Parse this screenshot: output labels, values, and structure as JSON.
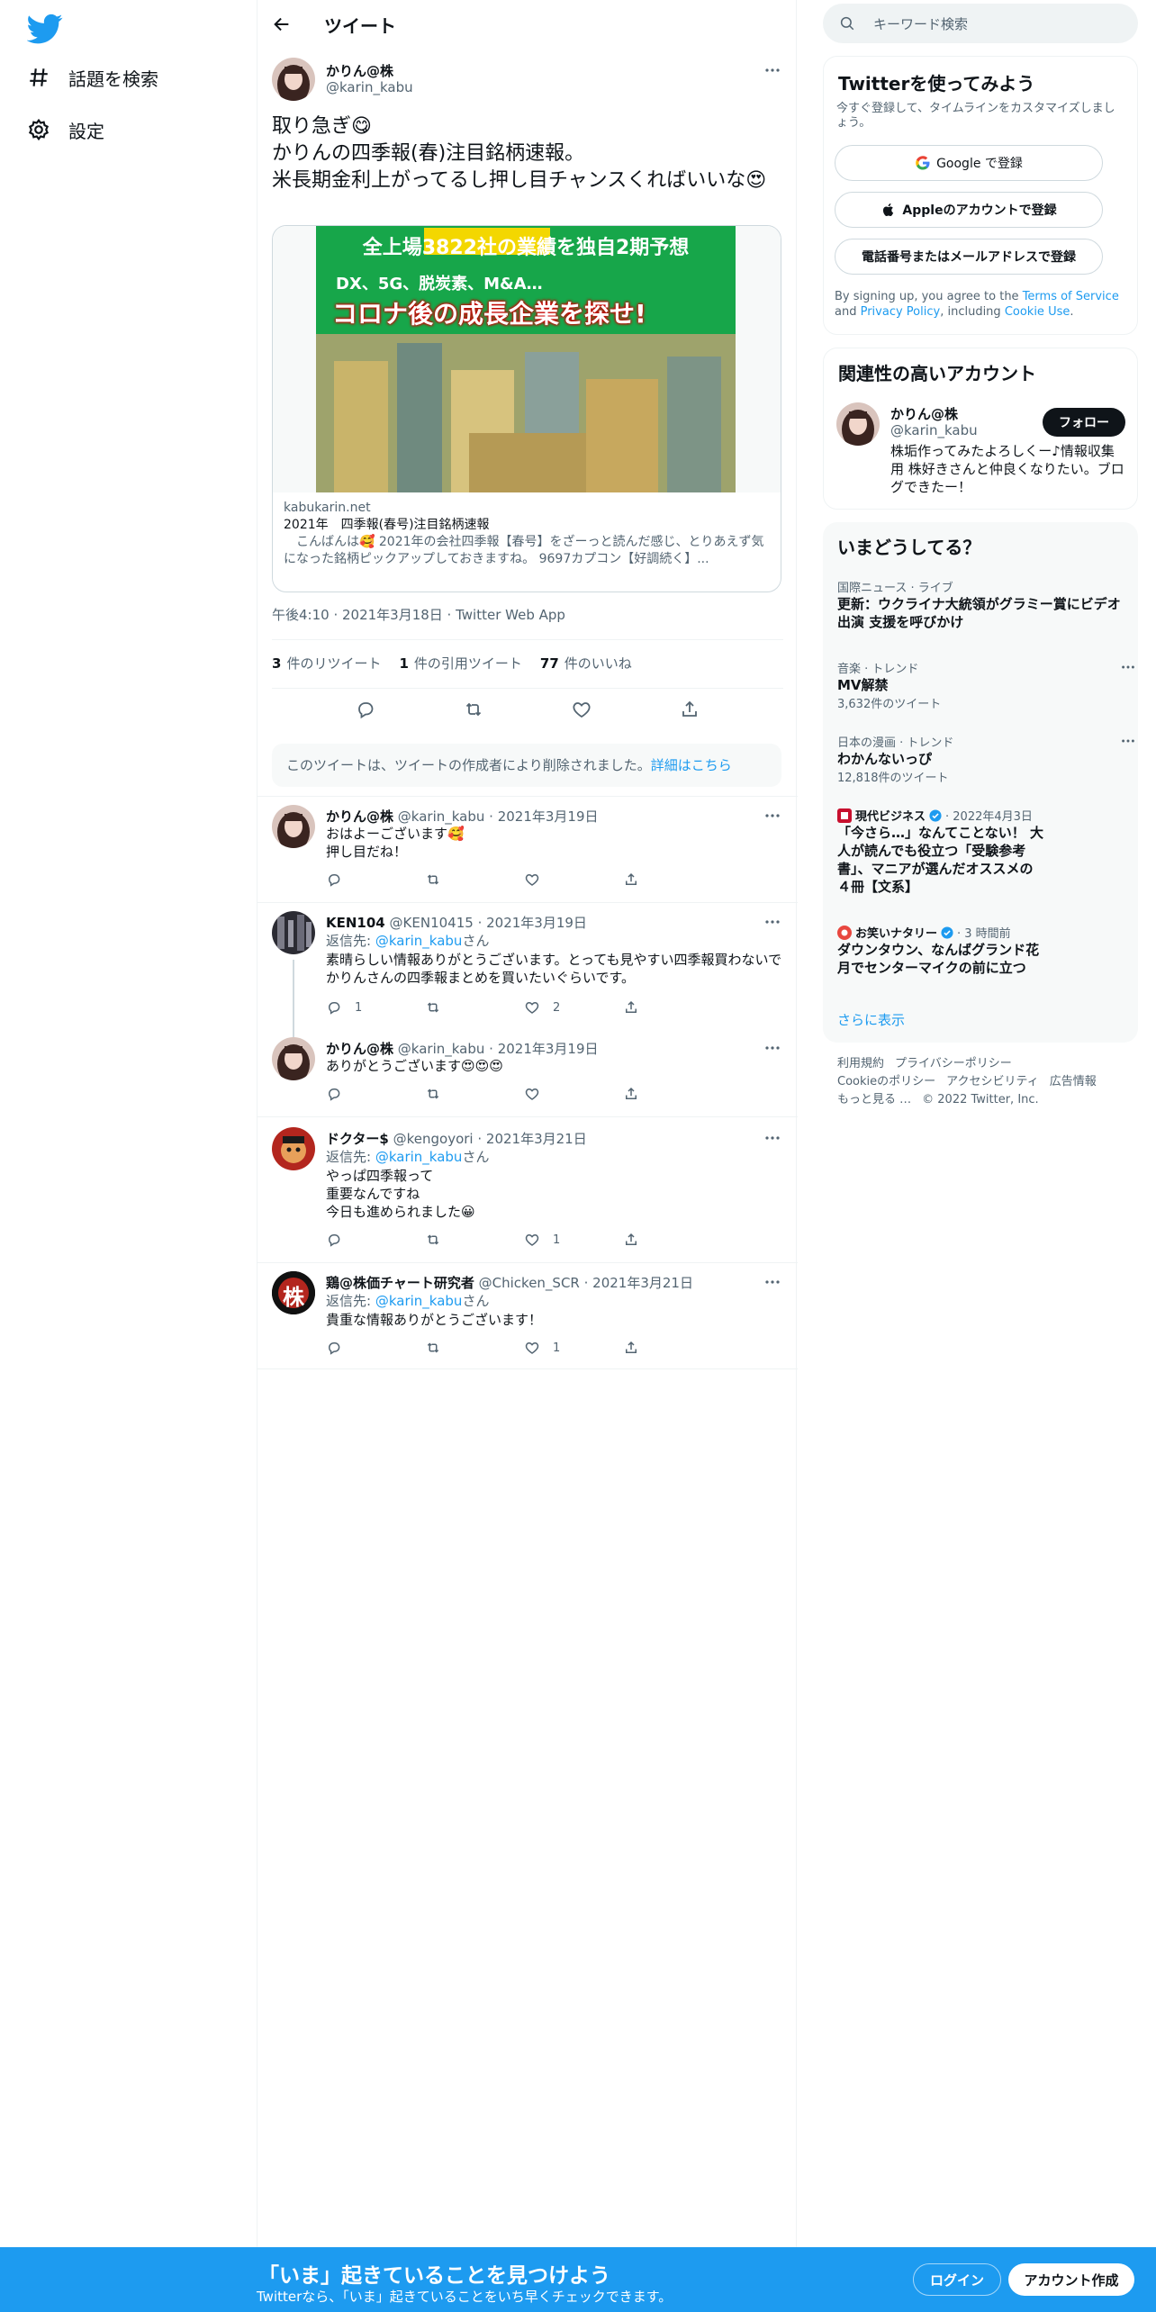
{
  "nav": {
    "items": [
      {
        "label": "話題を検索",
        "icon": "hashtag-icon"
      },
      {
        "label": "設定",
        "icon": "gear-icon"
      }
    ]
  },
  "header": {
    "title": "ツイート"
  },
  "tweet": {
    "name": "かりん@株",
    "handle": "@karin_kabu",
    "text": "取り急ぎ😋\nかりんの四季報(春)注目銘柄速報。\n米長期金利上がってるし押し目チャンスくればいいな😍",
    "card": {
      "image_line1": "全上場3822社の業績を独自2期予想",
      "image_line2": "DX、5G、脱炭素、M&A…",
      "image_line3": "コロナ後の成長企業を探せ!",
      "domain": "kabukarin.net",
      "title": "2021年　四季報(春号)注目銘柄速報",
      "desc": "　こんばんは🥰 2021年の会社四季報【春号】をざーっと読んだ感じ、とりあえず気になった銘柄ピックアップしておきますね。 9697カプコン【好調続く】..."
    },
    "time": "午後4:10 · 2021年3月18日 · Twitter Web App",
    "stats": {
      "retweets": "3",
      "retweets_label": "件のリツイート",
      "quotes": "1",
      "quotes_label": "件の引用ツイート",
      "likes": "77",
      "likes_label": "件のいいね"
    }
  },
  "notice": {
    "text": "このツイートは、ツイートの作成者により削除されました。",
    "link": "詳細はこちら"
  },
  "replies": [
    {
      "name": "かりん@株",
      "handle": "@karin_kabu",
      "date": "2021年3月19日",
      "replyto": "",
      "text": "おはよーございます🥰\n押し目だね！",
      "replies": "",
      "retweets": "",
      "likes": ""
    },
    {
      "name": "KEN104",
      "handle": "@KEN10415",
      "date": "2021年3月19日",
      "replyto_label": "返信先:",
      "replyto": "@karin_kabu",
      "replyto_suffix": "さん",
      "text": "素晴らしい情報ありがとうございます。とっても見やすい四季報買わないでかりんさんの四季報まとめを買いたいぐらいです。",
      "replies": "1",
      "retweets": "",
      "likes": "2"
    },
    {
      "name": "かりん@株",
      "handle": "@karin_kabu",
      "date": "2021年3月19日",
      "replyto": "",
      "text": "ありがとうございます😍😍😍",
      "replies": "",
      "retweets": "",
      "likes": ""
    },
    {
      "name": "ドクター$",
      "handle": "@kengoyori",
      "date": "2021年3月21日",
      "replyto_label": "返信先:",
      "replyto": "@karin_kabu",
      "replyto_suffix": "さん",
      "text": "やっぱ四季報って\n重要なんですね\n今日も進められました😀",
      "replies": "",
      "retweets": "",
      "likes": "1"
    },
    {
      "name": "鶏@株価チャート研究者",
      "handle": "@Chicken_SCR",
      "date": "2021年3月21日",
      "replyto_label": "返信先:",
      "replyto": "@karin_kabu",
      "replyto_suffix": "さん",
      "text": "貴重な情報ありがとうございます！",
      "replies": "",
      "retweets": "",
      "likes": "1",
      "avatar_char": "株"
    }
  ],
  "search": {
    "placeholder": "キーワード検索"
  },
  "signup_panel": {
    "title": "Twitterを使ってみよう",
    "subtitle": "今すぐ登録して、タイムラインをカスタマイズしましょう。",
    "google": "Google で登録",
    "apple": "Appleのアカウントで登録",
    "phone": "電話番号またはメールアドレスで登録",
    "legal_pre": "By signing up, you agree to the ",
    "terms": "Terms of Service",
    "legal_and": " and ",
    "privacy": "Privacy Policy",
    "legal_including": ", including ",
    "cookie": "Cookie Use",
    "legal_end": "."
  },
  "related": {
    "title": "関連性の高いアカウント",
    "name": "かりん@株",
    "handle": "@karin_kabu",
    "follow": "フォロー",
    "bio": "株垢作ってみたよろしくー♪情報収集用 株好きさんと仲良くなりたい。ブログできたー！"
  },
  "trends": {
    "title": "いまどうしてる？",
    "items": [
      {
        "cat": "国際ニュース · ライブ",
        "title": "更新：ウクライナ大統領がグラミー賞にビデオ出演 支援を呼びかけ",
        "count": ""
      },
      {
        "cat": "音楽 · トレンド",
        "title": "MV解禁",
        "count": "3,632件のツイート"
      },
      {
        "cat": "日本の漫画 · トレンド",
        "title": "わかんないっぴ",
        "count": "12,818件のツイート"
      },
      {
        "cat_source": "現代ビジネス",
        "cat_time": "· 2022年4月3日",
        "title": "「今さら…」なんてことない！ 大人が読んでも役立つ「受験参考書」、マニアが選んだオススメの４冊【文系】",
        "count": ""
      },
      {
        "cat_source": "お笑いナタリー",
        "cat_time": "· 3 時間前",
        "title": "ダウンタウン、なんばグランド花月でセンターマイクの前に立つ",
        "count": ""
      }
    ],
    "more": "さらに表示"
  },
  "footer": {
    "links": [
      "利用規約",
      "プライバシーポリシー",
      "Cookieのポリシー",
      "アクセシビリティ",
      "広告情報",
      "もっと見る …"
    ],
    "copyright": "© 2022 Twitter, Inc."
  },
  "bottombar": {
    "title": "「いま」起きていることを見つけよう",
    "subtitle": "Twitterなら、「いま」起きていることをいち早くチェックできます。",
    "login": "ログイン",
    "signup": "アカウント作成"
  },
  "colors": {
    "accent": "#1d9bf0",
    "text": "#0f1419",
    "muted": "#536471",
    "border": "#eff3f4"
  }
}
